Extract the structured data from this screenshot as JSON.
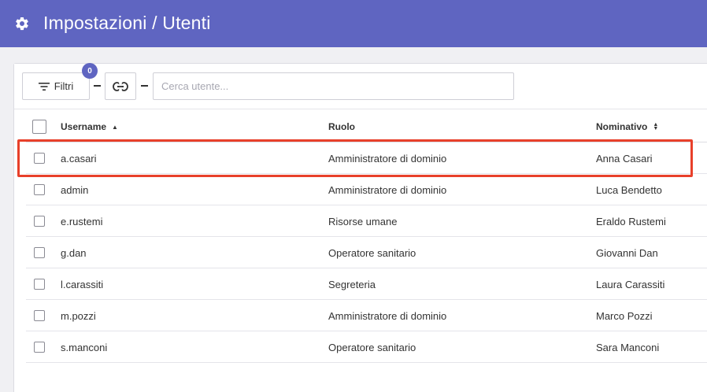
{
  "header": {
    "title": "Impostazioni / Utenti",
    "icon": "gear-icon",
    "background": "#5f65c1"
  },
  "toolbar": {
    "filter_label": "Filtri",
    "filter_count": "0",
    "search_placeholder": "Cerca utente..."
  },
  "table": {
    "columns": {
      "username": "Username",
      "role": "Ruolo",
      "name": "Nominativo"
    },
    "rows": [
      {
        "username": "a.casari",
        "role": "Amministratore di dominio",
        "name": "Anna Casari"
      },
      {
        "username": "admin",
        "role": "Amministratore di dominio",
        "name": "Luca Bendetto"
      },
      {
        "username": "e.rustemi",
        "role": "Risorse umane",
        "name": "Eraldo Rustemi"
      },
      {
        "username": "g.dan",
        "role": "Operatore sanitario",
        "name": "Giovanni Dan"
      },
      {
        "username": "l.carassiti",
        "role": "Segreteria",
        "name": "Laura Carassiti"
      },
      {
        "username": "m.pozzi",
        "role": "Amministratore di dominio",
        "name": "Marco Pozzi"
      },
      {
        "username": "s.manconi",
        "role": "Operatore sanitario",
        "name": "Sara Manconi"
      }
    ]
  },
  "highlight_color": "#e8402a"
}
